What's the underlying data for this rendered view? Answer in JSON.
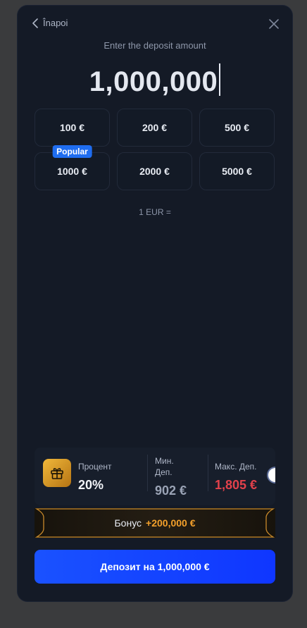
{
  "header": {
    "back_label": "Înapoi"
  },
  "deposit": {
    "prompt": "Enter the deposit amount",
    "amount": "1,000,000"
  },
  "presets": [
    {
      "label": "100 €"
    },
    {
      "label": "200 €"
    },
    {
      "label": "500 €"
    },
    {
      "label": "1000 €",
      "badge": "Popular"
    },
    {
      "label": "2000 €"
    },
    {
      "label": "5000 €"
    }
  ],
  "rate_text": "1 EUR =",
  "stats": {
    "percent_label": "Процент",
    "percent_value": "20%",
    "min_label_line1": "Мин.",
    "min_label_line2": "Деп.",
    "min_value": "902 €",
    "max_label": "Макс. Деп.",
    "max_value": "1,805 €",
    "bonus_toggle_on": false
  },
  "bonus": {
    "label": "Бонус",
    "value": "+200,000 €"
  },
  "submit_label": "Депозит на 1,000,000 €",
  "colors": {
    "accent": "#1a52ff",
    "bonus_value": "#f3a02b",
    "max_value": "#e2414b",
    "badge": "#1f6df0"
  }
}
